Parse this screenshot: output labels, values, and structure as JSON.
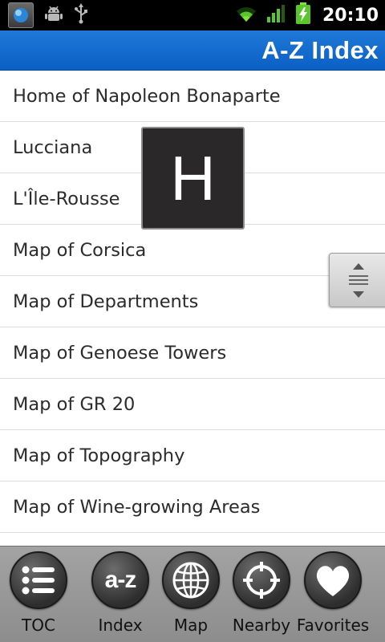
{
  "status_bar": {
    "time": "20:10",
    "icons": [
      "app-thumbnail-icon",
      "android-debug-icon",
      "usb-icon",
      "wifi-icon",
      "signal-icon",
      "battery-charging-icon"
    ]
  },
  "header": {
    "title": "A-Z Index"
  },
  "index": {
    "items": [
      {
        "label": "Home of Napoleon Bonaparte"
      },
      {
        "label": "Lucciana"
      },
      {
        "label": "L'Île-Rousse"
      },
      {
        "label": "Map of Corsica"
      },
      {
        "label": "Map of Departments"
      },
      {
        "label": "Map of Genoese Towers"
      },
      {
        "label": "Map of GR 20"
      },
      {
        "label": "Map of Topography"
      },
      {
        "label": "Map of Wine-growing Areas"
      }
    ],
    "section_letter": "H"
  },
  "tabbar": {
    "tabs": [
      {
        "label": "TOC",
        "icon": "toc-list-icon"
      },
      {
        "label": "Index",
        "icon": "az-index-icon",
        "glyph": "a-z"
      },
      {
        "label": "Map",
        "icon": "globe-icon"
      },
      {
        "label": "Nearby",
        "icon": "crosshair-icon"
      },
      {
        "label": "Favorites",
        "icon": "heart-icon"
      }
    ]
  },
  "colors": {
    "title_bar": "#0b5fc4",
    "tab_bar": "#999999",
    "popup_bg": "#2a2828"
  }
}
